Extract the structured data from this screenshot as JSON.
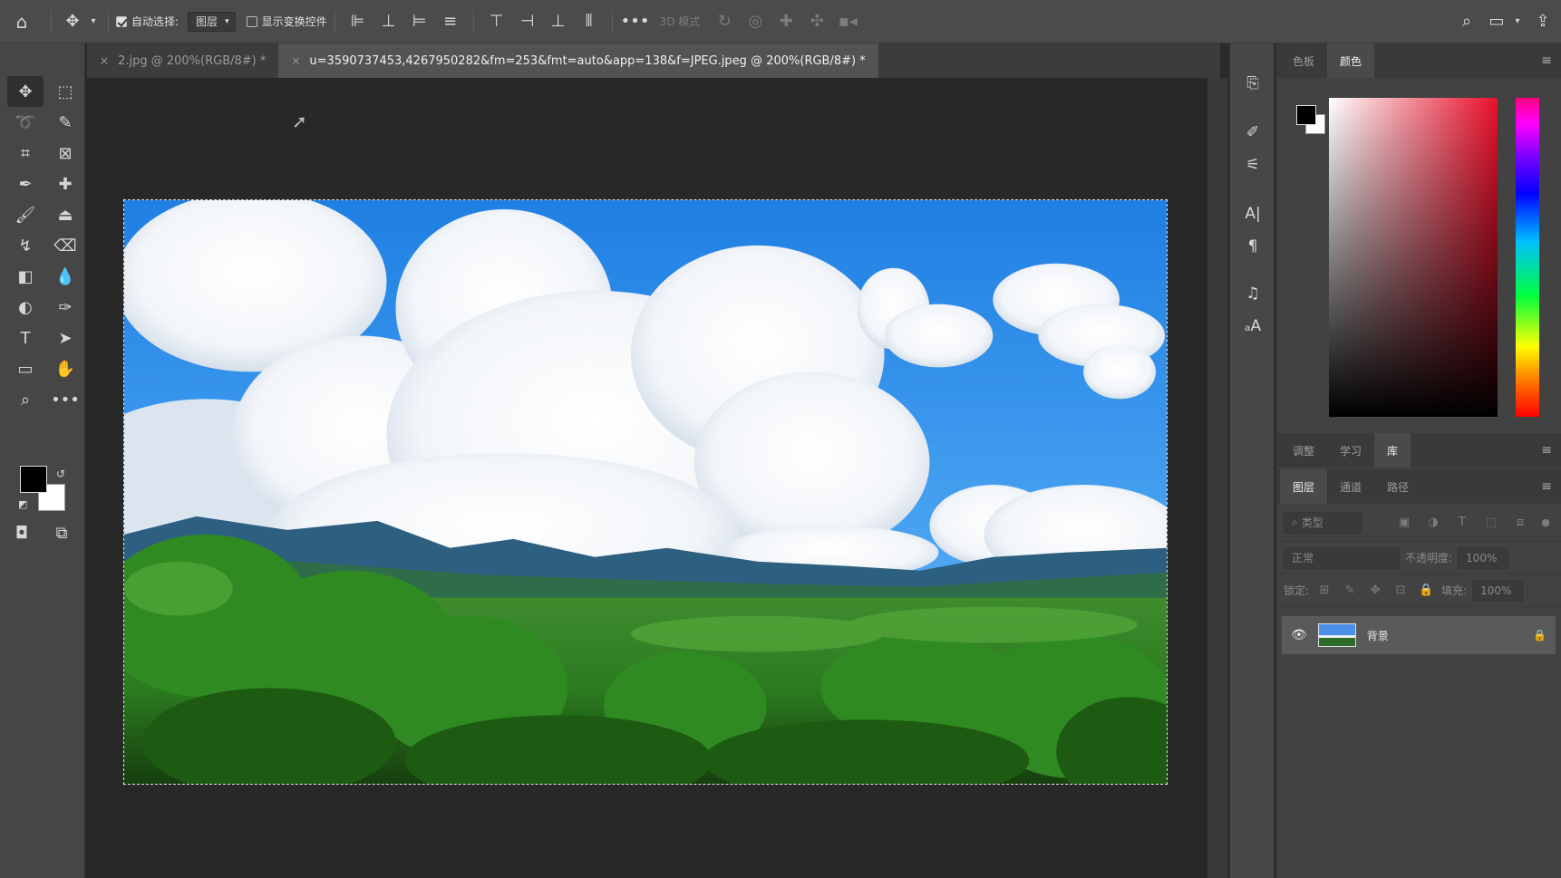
{
  "options_bar": {
    "auto_select_label": "自动选择:",
    "auto_select_target": "图层",
    "show_transform_label": "显示变换控件",
    "mode_3d_label": "3D 模式"
  },
  "document_tabs": [
    {
      "title": "2.jpg @ 200%(RGB/8#) *",
      "active": false
    },
    {
      "title": "u=3590737453,4267950282&fm=253&fmt=auto&app=138&f=JPEG.jpeg @ 200%(RGB/8#) *",
      "active": true
    }
  ],
  "color_panel": {
    "tabs": [
      "色板",
      "颜色"
    ],
    "active_tab": "颜色",
    "foreground": "#000000",
    "background": "#ffffff",
    "hue_color": "#e8102a"
  },
  "mid_panel_tabs": [
    "调整",
    "学习",
    "库"
  ],
  "layers_panel": {
    "tabs": [
      "图层",
      "通道",
      "路径"
    ],
    "active_tab": "图层",
    "filter_placeholder": "类型",
    "blend_mode": "正常",
    "opacity_label": "不透明度:",
    "opacity_value": "100%",
    "lock_label": "锁定:",
    "fill_label": "填充:",
    "fill_value": "100%",
    "layers": [
      {
        "name": "背景",
        "visible": true,
        "locked": true
      }
    ]
  }
}
